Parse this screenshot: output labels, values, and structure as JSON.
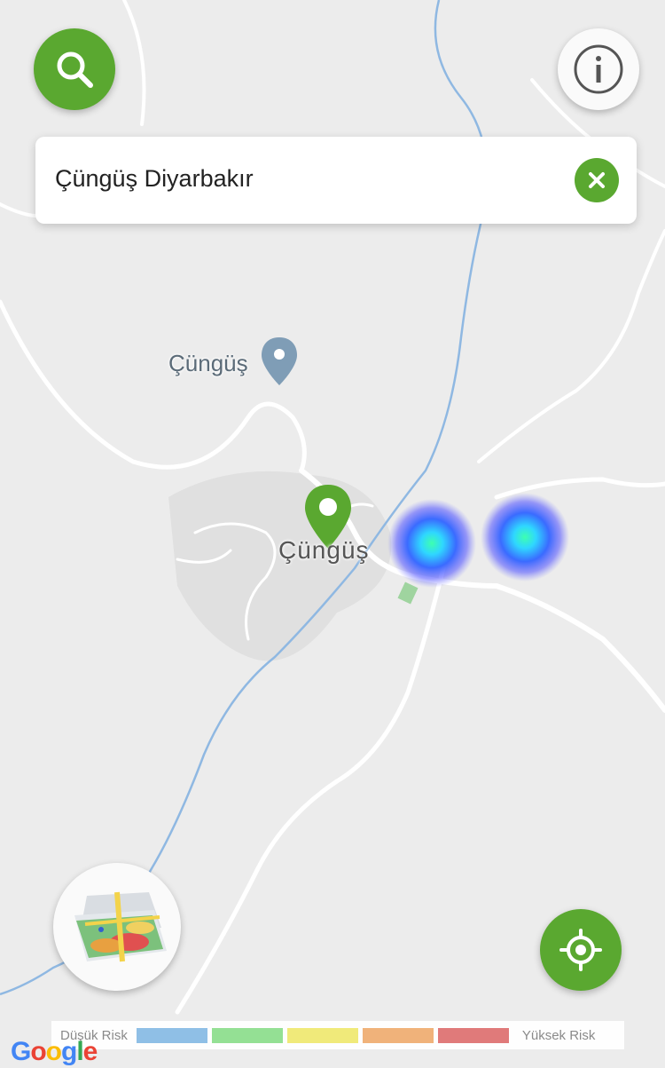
{
  "search": {
    "query": "Çüngüş Diyarbakır"
  },
  "map": {
    "place_label": "Çüngüş",
    "town_label": "Çüngüş",
    "colors": {
      "background": "#ececec",
      "road": "#ffffff",
      "river": "#8fb8e2",
      "town_area": "#dedede",
      "accent_green": "#5aa830",
      "place_pin": "#7f9db6"
    },
    "heat_spots": [
      {
        "name": "heat-spot-1",
        "intensity": "high"
      },
      {
        "name": "heat-spot-2",
        "intensity": "high"
      }
    ]
  },
  "buttons": {
    "search_icon": "search-icon",
    "info_icon": "info-icon",
    "clear_icon": "close-icon",
    "layers_icon": "map-layers-icon",
    "locate_icon": "crosshair-icon"
  },
  "legend": {
    "low_label": "Düşük Risk",
    "high_label": "Yüksek Risk",
    "colors": [
      "#8fbfe6",
      "#94e094",
      "#f0ea7a",
      "#f0b27a",
      "#e07a7a"
    ]
  },
  "attribution": {
    "text": "Google"
  }
}
